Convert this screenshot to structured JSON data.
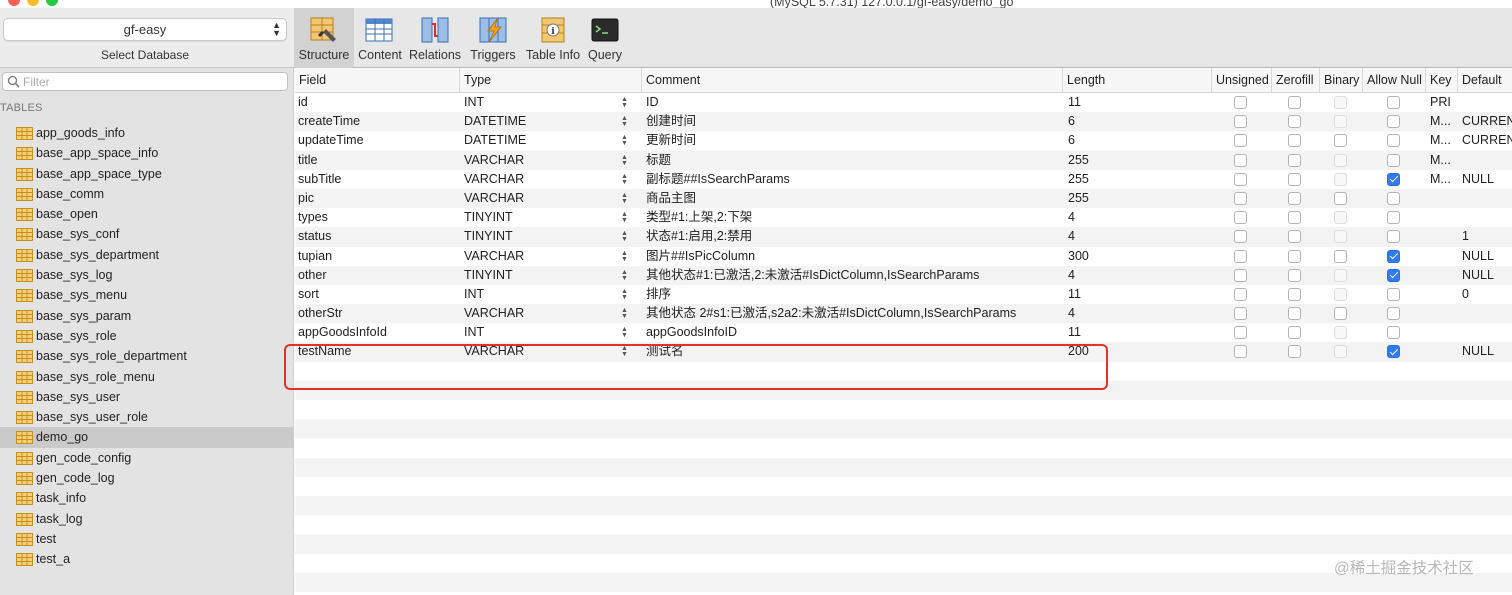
{
  "window": {
    "title": "(MySQL 5.7.31) 127.0.0.1/gf-easy/demo_go"
  },
  "database": {
    "selected": "gf-easy",
    "caption": "Select Database"
  },
  "toolbar": [
    {
      "id": "structure",
      "label": "Structure",
      "active": true
    },
    {
      "id": "content",
      "label": "Content",
      "active": false
    },
    {
      "id": "relations",
      "label": "Relations",
      "active": false
    },
    {
      "id": "triggers",
      "label": "Triggers",
      "active": false
    },
    {
      "id": "table-info",
      "label": "Table Info",
      "active": false
    },
    {
      "id": "query",
      "label": "Query",
      "active": false
    }
  ],
  "sidebar": {
    "filter_placeholder": "Filter",
    "tables_header": "TABLES",
    "tables": [
      {
        "name": "app_goods_info",
        "selected": false
      },
      {
        "name": "base_app_space_info",
        "selected": false
      },
      {
        "name": "base_app_space_type",
        "selected": false
      },
      {
        "name": "base_comm",
        "selected": false
      },
      {
        "name": "base_open",
        "selected": false
      },
      {
        "name": "base_sys_conf",
        "selected": false
      },
      {
        "name": "base_sys_department",
        "selected": false
      },
      {
        "name": "base_sys_log",
        "selected": false
      },
      {
        "name": "base_sys_menu",
        "selected": false
      },
      {
        "name": "base_sys_param",
        "selected": false
      },
      {
        "name": "base_sys_role",
        "selected": false
      },
      {
        "name": "base_sys_role_department",
        "selected": false
      },
      {
        "name": "base_sys_role_menu",
        "selected": false
      },
      {
        "name": "base_sys_user",
        "selected": false
      },
      {
        "name": "base_sys_user_role",
        "selected": false
      },
      {
        "name": "demo_go",
        "selected": true
      },
      {
        "name": "gen_code_config",
        "selected": false
      },
      {
        "name": "gen_code_log",
        "selected": false
      },
      {
        "name": "task_info",
        "selected": false
      },
      {
        "name": "task_log",
        "selected": false
      },
      {
        "name": "test",
        "selected": false
      },
      {
        "name": "test_a",
        "selected": false
      }
    ]
  },
  "structure": {
    "columns": [
      "Field",
      "Type",
      "Comment",
      "Length",
      "Unsigned",
      "Zerofill",
      "Binary",
      "Allow Null",
      "Key",
      "Default"
    ],
    "rows": [
      {
        "field": "id",
        "type": "INT",
        "comment": "ID",
        "length": "11",
        "unsigned": false,
        "zerofill": false,
        "binary": false,
        "allow_null": false,
        "key": "PRI",
        "default": ""
      },
      {
        "field": "createTime",
        "type": "DATETIME",
        "comment": "创建时间",
        "length": "6",
        "unsigned": false,
        "zerofill": false,
        "binary": false,
        "allow_null": false,
        "key": "M...",
        "default": "CURRENT"
      },
      {
        "field": "updateTime",
        "type": "DATETIME",
        "comment": "更新时间",
        "length": "6",
        "unsigned": false,
        "zerofill": false,
        "binary": false,
        "allow_null": false,
        "key": "M...",
        "default": "CURRENT"
      },
      {
        "field": "title",
        "type": "VARCHAR",
        "comment": "标题",
        "length": "255",
        "unsigned": false,
        "zerofill": false,
        "binary": false,
        "allow_null": false,
        "key": "M...",
        "default": ""
      },
      {
        "field": "subTitle",
        "type": "VARCHAR",
        "comment": "副标题##IsSearchParams",
        "length": "255",
        "unsigned": false,
        "zerofill": false,
        "binary": false,
        "allow_null": true,
        "key": "M...",
        "default": "NULL"
      },
      {
        "field": "pic",
        "type": "VARCHAR",
        "comment": "商品主图",
        "length": "255",
        "unsigned": false,
        "zerofill": false,
        "binary": false,
        "allow_null": false,
        "key": "",
        "default": ""
      },
      {
        "field": "types",
        "type": "TINYINT",
        "comment": "类型#1:上架,2:下架",
        "length": "4",
        "unsigned": false,
        "zerofill": false,
        "binary": false,
        "allow_null": false,
        "key": "",
        "default": ""
      },
      {
        "field": "status",
        "type": "TINYINT",
        "comment": "状态#1:启用,2:禁用",
        "length": "4",
        "unsigned": false,
        "zerofill": false,
        "binary": false,
        "allow_null": false,
        "key": "",
        "default": "1"
      },
      {
        "field": "tupian",
        "type": "VARCHAR",
        "comment": "图片##IsPicColumn",
        "length": "300",
        "unsigned": false,
        "zerofill": false,
        "binary": false,
        "allow_null": true,
        "key": "",
        "default": "NULL"
      },
      {
        "field": "other",
        "type": "TINYINT",
        "comment": "其他状态#1:已激活,2:未激活#IsDictColumn,IsSearchParams",
        "length": "4",
        "unsigned": false,
        "zerofill": false,
        "binary": false,
        "allow_null": true,
        "key": "",
        "default": "NULL"
      },
      {
        "field": "sort",
        "type": "INT",
        "comment": "排序",
        "length": "11",
        "unsigned": false,
        "zerofill": false,
        "binary": false,
        "allow_null": false,
        "key": "",
        "default": "0"
      },
      {
        "field": "otherStr",
        "type": "VARCHAR",
        "comment": "其他状态 2#s1:已激活,s2a2:未激活#IsDictColumn,IsSearchParams",
        "length": "4",
        "unsigned": false,
        "zerofill": false,
        "binary": false,
        "allow_null": false,
        "key": "",
        "default": ""
      },
      {
        "field": "appGoodsInfoId",
        "type": "INT",
        "comment": "appGoodsInfoID",
        "length": "11",
        "unsigned": false,
        "zerofill": false,
        "binary": false,
        "allow_null": false,
        "key": "",
        "default": ""
      },
      {
        "field": "testName",
        "type": "VARCHAR",
        "comment": "测试名",
        "length": "200",
        "unsigned": false,
        "zerofill": false,
        "binary": false,
        "allow_null": true,
        "key": "",
        "default": "NULL"
      }
    ]
  },
  "watermark": "@稀土掘金技术社区",
  "colors": {
    "highlight": "#e0322b",
    "checkbox_checked": "#2f7bf5",
    "table_icon": "#f0b43c"
  }
}
